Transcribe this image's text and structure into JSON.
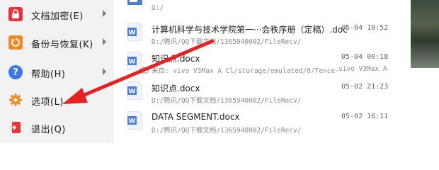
{
  "menu": {
    "items": [
      {
        "label": "文档加密(E)",
        "icon": "lock-icon",
        "color": "#e8333a",
        "has_submenu": true
      },
      {
        "label": "备份与恢复(K)",
        "icon": "backup-icon",
        "color": "#f08a24",
        "has_submenu": true
      },
      {
        "label": "帮助(H)",
        "icon": "help-icon",
        "color": "#3b78e7",
        "has_submenu": true
      },
      {
        "label": "选项(L)",
        "icon": "gear-icon",
        "color": "#f08a24",
        "has_submenu": false
      },
      {
        "label": "退出(Q)",
        "icon": "exit-icon",
        "color": "#e8333a",
        "has_submenu": false
      }
    ]
  },
  "documents": [
    {
      "title": "",
      "path": "G:/",
      "date": "",
      "device": ""
    },
    {
      "title": "计算机科学与技术学院第一···会秩序册（定稿）.doc",
      "path": "D:/腾讯/QQ下载文档/1365940002/FileRecv/",
      "date": "05-04 10:52",
      "device": ""
    },
    {
      "title": "知识点.docx",
      "path": "来自: vivo V3Max A Cl/storage/emulated/0/Tence···",
      "date": "05-04 00:18",
      "device": "vivo V3Max A"
    },
    {
      "title": "知识点.docx",
      "path": "D:/腾讯/QQ下载文档/1365940002/FileRecv/",
      "date": "05-02 21:23",
      "device": ""
    },
    {
      "title": "DATA SEGMENT.docx",
      "path": "D:/腾讯/QQ下载文档/1365940002/FileRecv/",
      "date": "05-02 16:11",
      "device": ""
    }
  ],
  "colors": {
    "word_blue": "#4a7fd6",
    "annotation_arrow": "#e52222"
  }
}
